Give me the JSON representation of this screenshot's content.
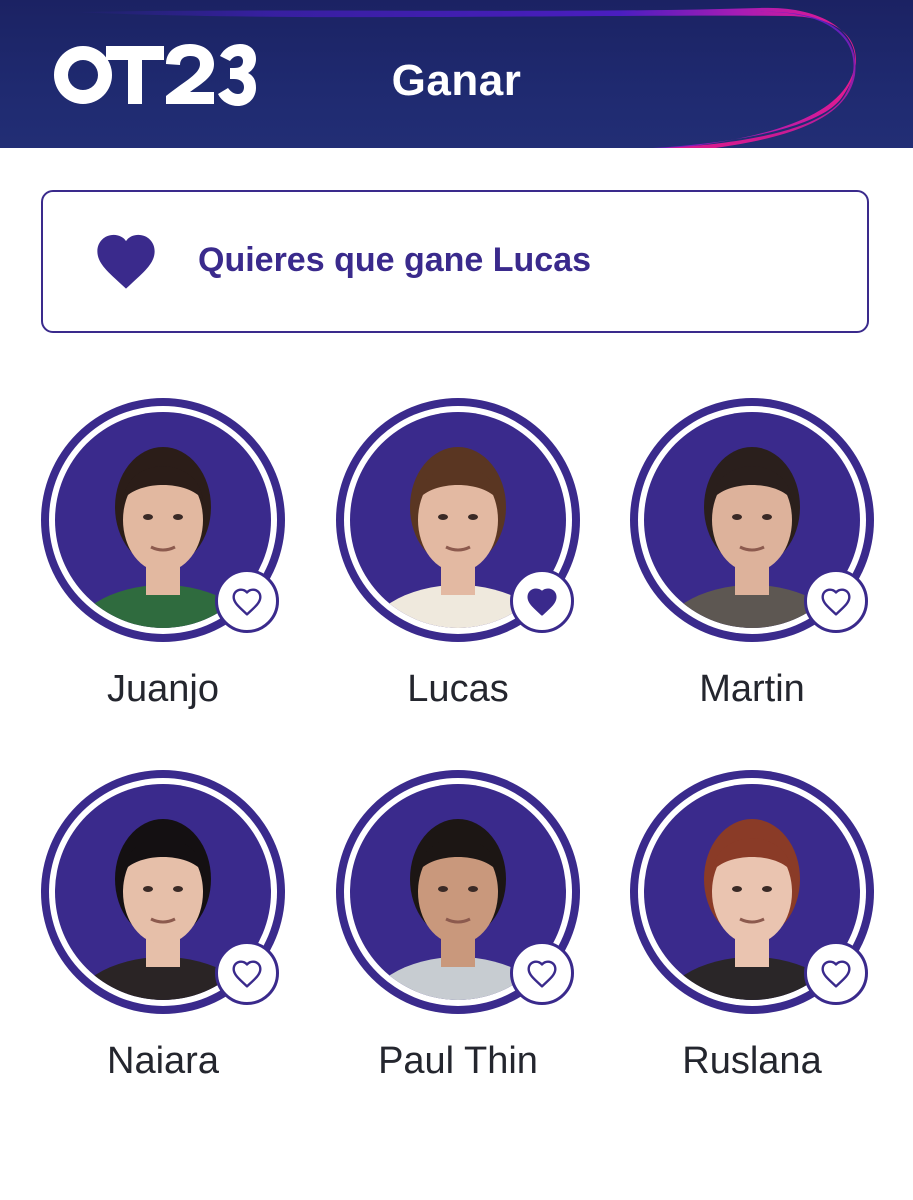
{
  "header": {
    "logo_text": "OT23",
    "title": "Ganar"
  },
  "vote_banner": {
    "icon": "heart-filled-icon",
    "text": "Quieres que gane Lucas"
  },
  "colors": {
    "accent": "#3a2a8c",
    "header_bg": "#1d2568",
    "swoosh_purple": "#3b1fa8",
    "swoosh_pink": "#e5198e"
  },
  "contestants": [
    {
      "name": "Juanjo",
      "favorite": false,
      "icon": "heart-outline-icon"
    },
    {
      "name": "Lucas",
      "favorite": true,
      "icon": "heart-filled-icon"
    },
    {
      "name": "Martin",
      "favorite": false,
      "icon": "heart-outline-icon"
    },
    {
      "name": "Naiara",
      "favorite": false,
      "icon": "heart-outline-icon"
    },
    {
      "name": "Paul Thin",
      "favorite": false,
      "icon": "heart-outline-icon"
    },
    {
      "name": "Ruslana",
      "favorite": false,
      "icon": "heart-outline-icon"
    }
  ]
}
